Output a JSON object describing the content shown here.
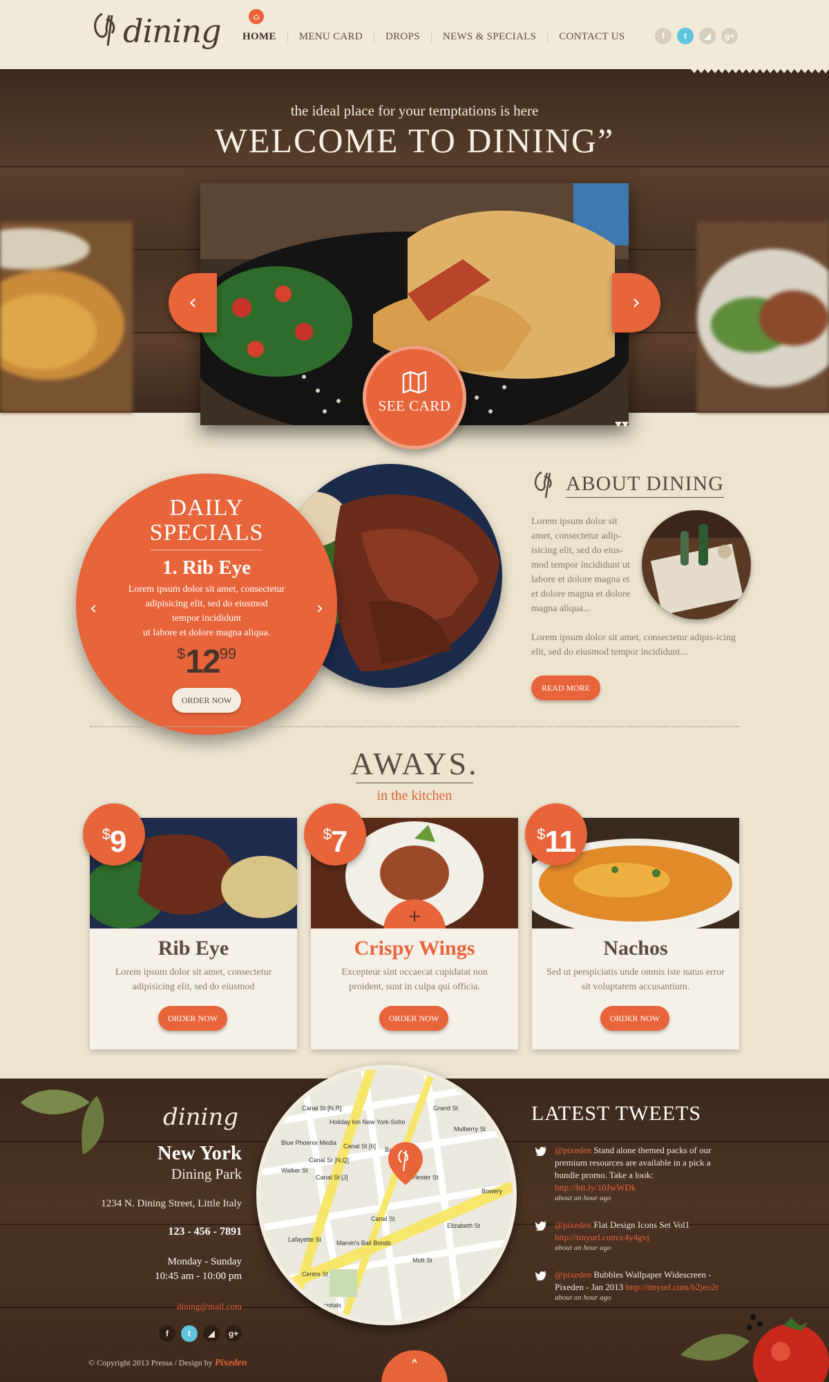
{
  "colors": {
    "accent": "#e8643a",
    "background": "#ece4cf",
    "wood": "#4a3323",
    "text": "#5a4a40",
    "twitter": "#5ec5dd"
  },
  "header": {
    "logo_text": "dining",
    "nav": [
      {
        "label": "HOME",
        "active": true
      },
      {
        "label": "MENU CARD"
      },
      {
        "label": "DROPS"
      },
      {
        "label": "NEWS & SPECIALS"
      },
      {
        "label": "CONTACT US"
      }
    ],
    "home_icon": "home-icon",
    "social": [
      {
        "icon": "facebook-icon",
        "glyph": "f"
      },
      {
        "icon": "twitter-icon",
        "glyph": "t"
      },
      {
        "icon": "rss-icon",
        "glyph": "◢"
      },
      {
        "icon": "google-plus-icon",
        "glyph": "g+"
      }
    ]
  },
  "hero": {
    "subtitle": "the ideal place for your temptations is here",
    "title": "WELCOME TO DINING”",
    "prev_arrow": "‹",
    "next_arrow": "›",
    "see_card_label": "SEE CARD",
    "see_card_icon": "map-icon"
  },
  "specials": {
    "title_line1": "DAILY",
    "title_line2": "SPECIALS",
    "item": "1. Rib Eye",
    "desc_line1": "Lorem ipsum dolor sit amet, consectetur",
    "desc_line2": "adipisicing elit, sed do eiusmod",
    "desc_line3": "tempor incididunt",
    "desc_line4": "ut labore et dolore magna aliqua.",
    "currency": "$",
    "price_main": "12",
    "price_cents": "99",
    "order_label": "ORDER NOW",
    "prev_arrow": "‹",
    "next_arrow": "›"
  },
  "about": {
    "title": "ABOUT DINING",
    "text1": "Lorem ipsum dolor sit amet, consectetur adip-isicing elit, sed do eius-mod tempor incididunt ut labore et dolore magna et et dolore magna et dolore magna aliqua...",
    "text2": "Lorem ipsum dolor sit amet, consectetur adipis-icing elit, sed do eiusmod tempor incididunt...",
    "read_more": "READ MORE"
  },
  "always": {
    "title": "AWAYS.",
    "subtitle": "in the kitchen",
    "cards": [
      {
        "currency": "$",
        "price": "9",
        "title": "Rib Eye",
        "desc": "Lorem ipsum dolor sit amet, consectetur adipisicing elit, sed do eiusmod",
        "order": "ORDER NOW"
      },
      {
        "currency": "$",
        "price": "7",
        "title": "Crispy Wings",
        "desc": "Excepteur sint occaecat cupidatat non proident, sunt in culpa qui officia.",
        "order": "ORDER NOW",
        "plus": "+"
      },
      {
        "currency": "$",
        "price": "11",
        "title": "Nachos",
        "desc": "Sed ut perspiciatis unde omnis iste natus error sit voluptatem accusantium.",
        "order": "ORDER NOW"
      }
    ]
  },
  "footer": {
    "logo_text": "dining",
    "city": "New York",
    "park": "Dining Park",
    "address": "1234 N. Dining Street, Little Italy",
    "phone": "123 - 456 - 7891",
    "days": "Monday - Sunday",
    "hours": "10:45 am - 10:00 pm",
    "email": "dining@mail.com",
    "social": [
      {
        "icon": "facebook-icon",
        "glyph": "f"
      },
      {
        "icon": "twitter-icon",
        "glyph": "t"
      },
      {
        "icon": "rss-icon",
        "glyph": "◢"
      },
      {
        "icon": "google-plus-icon",
        "glyph": "g+"
      }
    ],
    "map_labels": [
      "Canal St [N,R]",
      "Holiday Inn New York-Soho",
      "Blue Phoenix Media",
      "Canal St [6]",
      "Canal St [N,Q]",
      "Canal St [J]",
      "Walker St",
      "Lafayette St",
      "Canal St",
      "Centre St",
      "Baxter St",
      "Hester St",
      "Grand St",
      "Mulberry St",
      "Mott St",
      "Elizabeth St",
      "Bowery",
      "Marvin's Bail Bonds",
      "Hospitals"
    ],
    "tweets_title": "LATEST TWEETS",
    "tweets": [
      {
        "user": "@pixeden",
        "text": " Stand alone themed packs of our premium resources are available in a pick a bundle promo. Take a look: ",
        "link": "http://bit.ly/10JwWDk",
        "time": "about an hour ago"
      },
      {
        "user": "@pixeden",
        "text": " Flat Design Icons Set Vol1 ",
        "link": "http://tinyurl.com/c4y4gvj",
        "time": "about an hour ago"
      },
      {
        "user": "@pixeden",
        "text": " Bubbles Wallpaper Widescreen - Pixeden - Jan 2013 ",
        "link": "http://tinyurl.com/b2jeo2r",
        "time": "about an hour ago"
      }
    ],
    "copyright": "© Copyright 2013 Pressa / Design by ",
    "copyright_brand": "Pixeden",
    "to_top": "˄"
  }
}
